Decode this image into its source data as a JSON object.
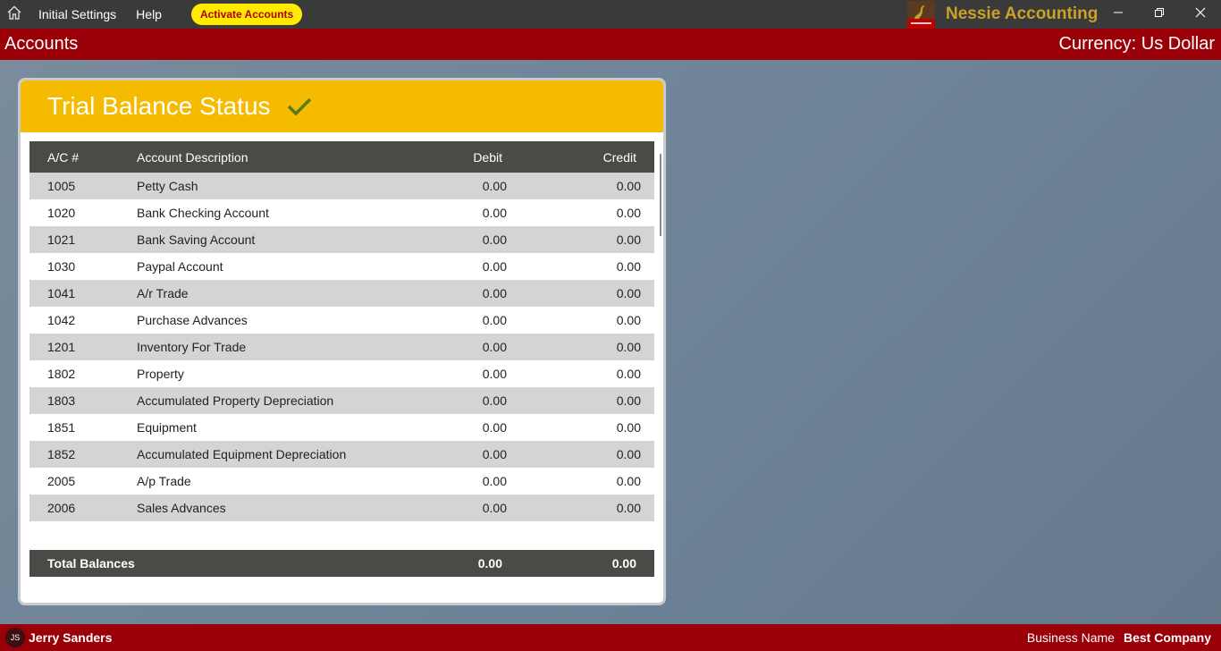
{
  "menubar": {
    "home_icon": "home-icon",
    "items": [
      "Initial Settings",
      "Help"
    ],
    "activate_label": "Activate Accounts",
    "brand_name": "Nessie Accounting",
    "window_controls": [
      "minimize-icon",
      "restore-icon",
      "close-icon"
    ]
  },
  "header": {
    "title": "Accounts",
    "currency": "Currency: Us Dollar"
  },
  "card": {
    "title": "Trial Balance Status",
    "status_icon": "checkmark-icon",
    "columns": [
      "A/C #",
      "Account Description",
      "Debit",
      "Credit"
    ],
    "rows": [
      {
        "ac": "1005",
        "desc": "Petty Cash",
        "debit": "0.00",
        "credit": "0.00"
      },
      {
        "ac": "1020",
        "desc": "Bank Checking Account",
        "debit": "0.00",
        "credit": "0.00"
      },
      {
        "ac": "1021",
        "desc": "Bank Saving Account",
        "debit": "0.00",
        "credit": "0.00"
      },
      {
        "ac": "1030",
        "desc": "Paypal Account",
        "debit": "0.00",
        "credit": "0.00"
      },
      {
        "ac": "1041",
        "desc": "A/r Trade",
        "debit": "0.00",
        "credit": "0.00"
      },
      {
        "ac": "1042",
        "desc": "Purchase Advances",
        "debit": "0.00",
        "credit": "0.00"
      },
      {
        "ac": "1201",
        "desc": "Inventory For Trade",
        "debit": "0.00",
        "credit": "0.00"
      },
      {
        "ac": "1802",
        "desc": "Property",
        "debit": "0.00",
        "credit": "0.00"
      },
      {
        "ac": "1803",
        "desc": "Accumulated Property Depreciation",
        "debit": "0.00",
        "credit": "0.00"
      },
      {
        "ac": "1851",
        "desc": "Equipment",
        "debit": "0.00",
        "credit": "0.00"
      },
      {
        "ac": "1852",
        "desc": "Accumulated Equipment Depreciation",
        "debit": "0.00",
        "credit": "0.00"
      },
      {
        "ac": "2005",
        "desc": "A/p Trade",
        "debit": "0.00",
        "credit": "0.00"
      },
      {
        "ac": "2006",
        "desc": "Sales Advances",
        "debit": "0.00",
        "credit": "0.00"
      }
    ],
    "total": {
      "label": "Total Balances",
      "debit": "0.00",
      "credit": "0.00"
    }
  },
  "footer": {
    "avatar_initials": "JS",
    "user_name": "Jerry Sanders",
    "business_label": "Business Name",
    "business_value": "Best Company"
  },
  "colors": {
    "menubar": "#3a3a3a",
    "accent_red": "#9a0008",
    "card_header": "#f5bb00",
    "activate_button": "#ffea00",
    "brand_text": "#c9a227",
    "check": "#5a7a1a"
  }
}
